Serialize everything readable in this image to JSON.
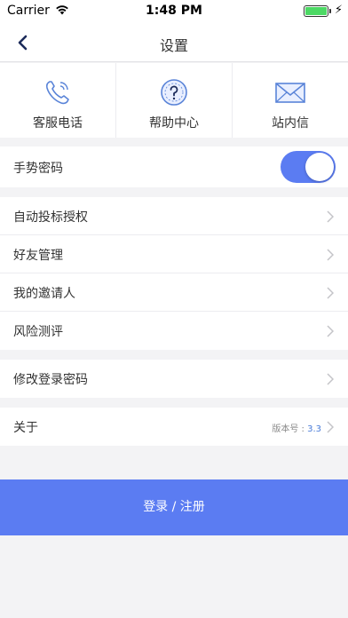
{
  "status_bar": {
    "carrier": "Carrier",
    "time": "1:48 PM",
    "battery_level": 1.0
  },
  "nav": {
    "title": "设置",
    "back_icon": "chevron-left-icon"
  },
  "quick_actions": [
    {
      "label": "客服电话",
      "icon": "phone-icon"
    },
    {
      "label": "帮助中心",
      "icon": "help-icon"
    },
    {
      "label": "站内信",
      "icon": "mail-icon"
    }
  ],
  "gesture": {
    "label": "手势密码",
    "enabled": true
  },
  "menu": [
    {
      "label": "自动投标授权"
    },
    {
      "label": "好友管理"
    },
    {
      "label": "我的邀请人"
    },
    {
      "label": "风险测评"
    }
  ],
  "password": {
    "label": "修改登录密码"
  },
  "about": {
    "label": "关于",
    "version_label": "版本号 : ",
    "version": "3.3"
  },
  "login_button": "登录 / 注册",
  "colors": {
    "accent": "#5b7cf2",
    "icon_blue": "#5a84d8",
    "background": "#f3f3f5"
  }
}
